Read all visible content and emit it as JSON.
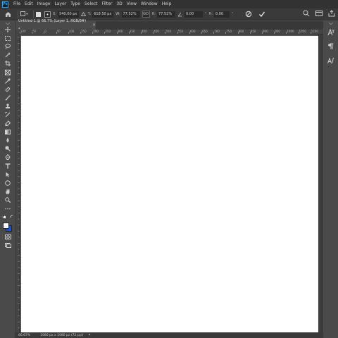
{
  "app": {
    "logo": "Ps"
  },
  "menu": [
    "File",
    "Edit",
    "Image",
    "Layer",
    "Type",
    "Select",
    "Filter",
    "3D",
    "View",
    "Window",
    "Help"
  ],
  "options": {
    "x_label": "X:",
    "x_value": "540.00 px",
    "y_label": "Y:",
    "y_value": "618.50 px",
    "w_label": "W:",
    "w_value": "77.52%",
    "link_label": "GO",
    "h_label": "H:",
    "h_value": "77.52%",
    "angle_value": "0.00",
    "h_skew_label": "H:",
    "h_skew_value": "0.00"
  },
  "document": {
    "tab_title": "Untitled-1 @ 66.7% (Layer 1, RGB/8#) *",
    "close_glyph": "×"
  },
  "ruler_ticks": [
    "100",
    "50",
    "0",
    "50",
    "100",
    "150",
    "200",
    "250",
    "300",
    "350",
    "400",
    "450",
    "500",
    "550",
    "600",
    "650",
    "700",
    "750",
    "800",
    "850",
    "900",
    "950",
    "1000",
    "1050",
    "1100"
  ],
  "status": {
    "zoom": "66.67%",
    "doc_info": "1080 px x 1080 px (72 ppi)"
  },
  "colors": {
    "foreground": "#ffffff",
    "background": "#1f4fd6",
    "accent": "#31a8ff"
  }
}
